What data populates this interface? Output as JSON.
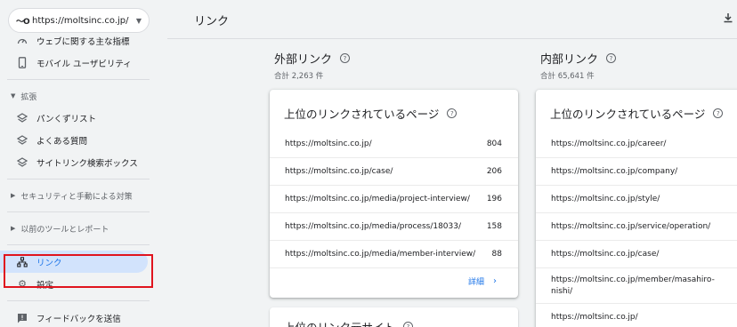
{
  "property": {
    "logo": "〜O",
    "url": "https://moltsinc.co.jp/"
  },
  "nav": {
    "items_top": [
      {
        "icon": "gauge-icon",
        "label": "ウェブに関する主な指標"
      },
      {
        "icon": "smartphone-icon",
        "label": "モバイル ユーザビリティ"
      }
    ],
    "section_ext": "拡張",
    "items_ext": [
      {
        "icon": "layers-icon",
        "label": "パンくずリスト"
      },
      {
        "icon": "layers-icon",
        "label": "よくある質問"
      },
      {
        "icon": "layers-icon",
        "label": "サイトリンク検索ボックス"
      }
    ],
    "section_security": "セキュリティと手動による対策",
    "section_legacy": "以前のツールとレポート",
    "active_item": {
      "icon": "sitemap-icon",
      "label": "リンク"
    },
    "settings": {
      "icon": "gear-icon",
      "label": "設定"
    },
    "feedback": {
      "icon": "feedback-icon",
      "label": "フィードバックを送信"
    }
  },
  "header": {
    "title": "リンク",
    "download_icon": "download-icon"
  },
  "external": {
    "title": "外部リンク",
    "total": "合計 2,263 件",
    "card_title": "上位のリンクされているページ",
    "rows": [
      {
        "url": "https://moltsinc.co.jp/",
        "count": "804"
      },
      {
        "url": "https://moltsinc.co.jp/case/",
        "count": "206"
      },
      {
        "url": "https://moltsinc.co.jp/media/project-interview/",
        "count": "196"
      },
      {
        "url": "https://moltsinc.co.jp/media/process/18033/",
        "count": "158"
      },
      {
        "url": "https://moltsinc.co.jp/media/member-interview/",
        "count": "88"
      }
    ],
    "more": "詳細",
    "next_card_title": "上位のリンク元サイト"
  },
  "internal": {
    "title": "内部リンク",
    "total": "合計 65,641 件",
    "card_title": "上位のリンクされているページ",
    "rows": [
      {
        "url": "https://moltsinc.co.jp/career/"
      },
      {
        "url": "https://moltsinc.co.jp/company/"
      },
      {
        "url": "https://moltsinc.co.jp/style/"
      },
      {
        "url": "https://moltsinc.co.jp/service/operation/"
      },
      {
        "url": "https://moltsinc.co.jp/case/"
      },
      {
        "url": "https://moltsinc.co.jp/member/masahiro-nishi/"
      },
      {
        "url": "https://moltsinc.co.jp/"
      }
    ]
  }
}
